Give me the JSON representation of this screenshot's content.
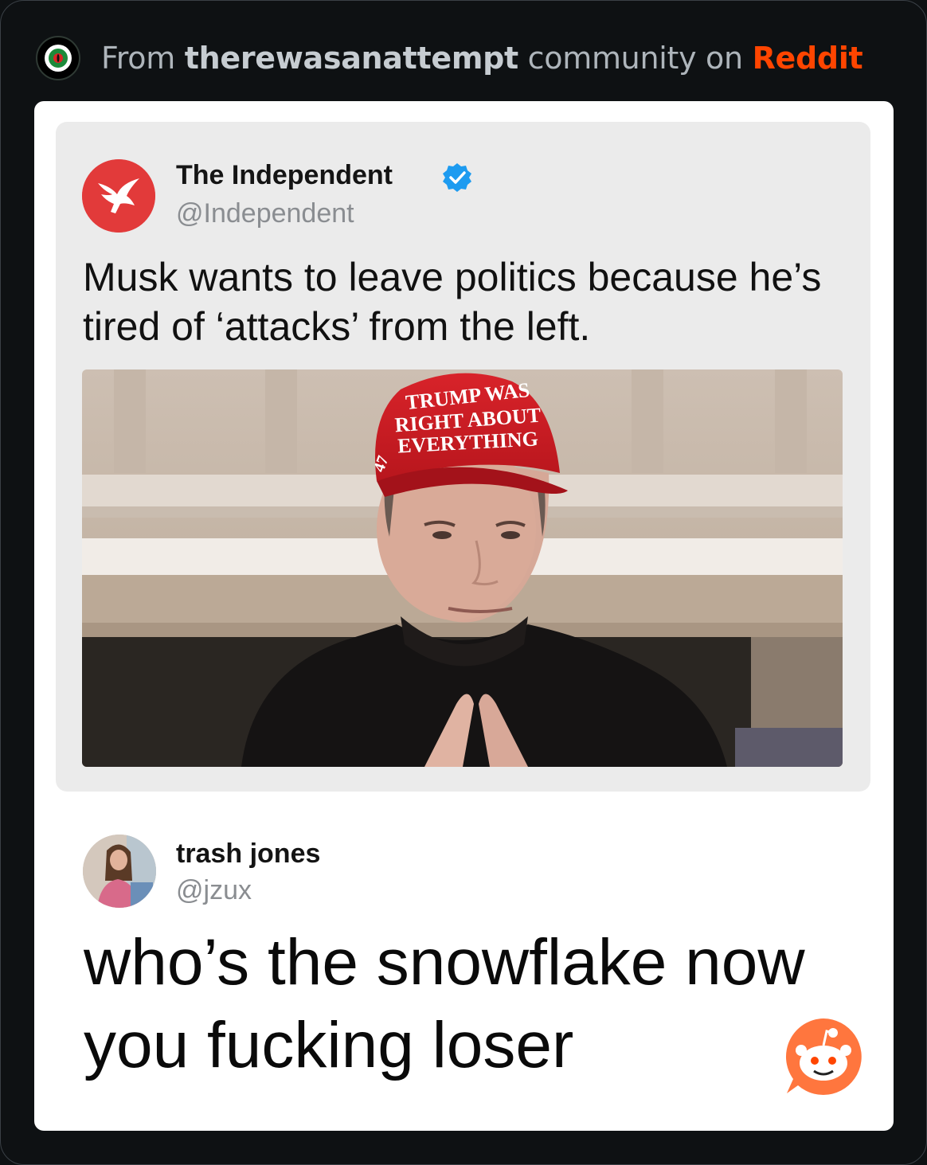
{
  "header": {
    "prefix": "From ",
    "community": "therewasanattempt",
    "middle": " community on ",
    "platform": "Reddit",
    "community_icon": "subreddit-eye-icon"
  },
  "tweets": [
    {
      "name": "The Independent",
      "handle": "@Independent",
      "verified": true,
      "text": "Musk wants to leave politics because he’s tired of ‘attacks’ from the left.",
      "image": {
        "description_icon": "photo-man-in-red-cap",
        "cap_lines": [
          "TRUMP WAS",
          "RIGHT ABOUT",
          "EVERYTHING"
        ],
        "cap_side": "47"
      }
    },
    {
      "name": "trash jones",
      "handle": "@jzux",
      "verified": false,
      "text": "who’s the snowflake now you fucking loser"
    }
  ],
  "colors": {
    "background": "#0e1113",
    "reddit_orange": "#ff4500",
    "verified_blue": "#1d9bf0",
    "independent_red": "#e23a3a"
  },
  "watermark_icon": "reddit-snoo-icon"
}
